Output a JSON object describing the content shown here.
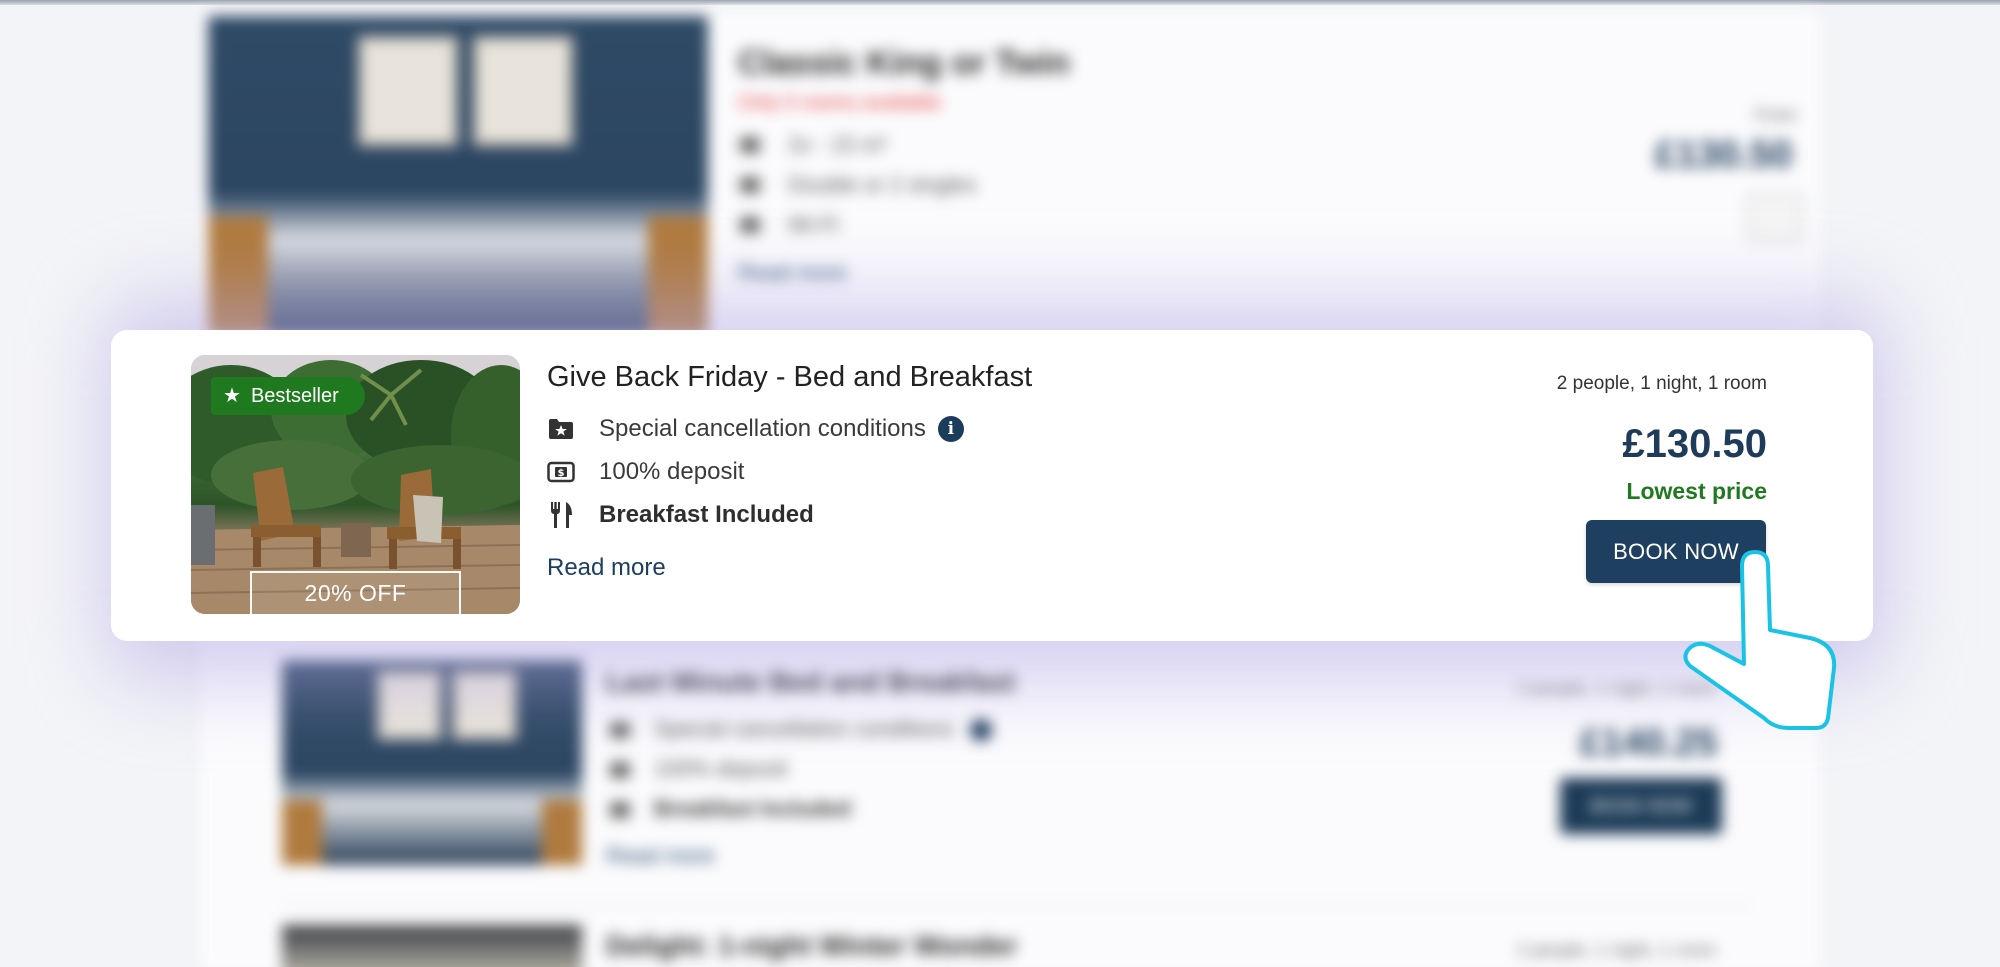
{
  "background_list": {
    "items": [
      {
        "title": "Classic King or Twin",
        "notice": "Only 5 rooms available",
        "features": [
          "2x - 15 m²",
          "Double or 2 singles",
          "Wi-Fi"
        ],
        "read_more": "Read more",
        "price_caption": "From",
        "price": "£130.50",
        "quantity": "1"
      },
      {
        "title": "Last Minute Bed and Breakfast",
        "features": [
          "Special cancellation conditions",
          "100% deposit",
          "Breakfast Included"
        ],
        "read_more": "Read more",
        "occupancy": "2 people, 1 night, 1 room",
        "price": "£140.25",
        "button": "BOOK NOW"
      },
      {
        "title": "Delight: 1-night Winter Wonder",
        "occupancy": "2 people, 1 night, 1 room"
      }
    ]
  },
  "offer": {
    "badge": "Bestseller",
    "discount": "20% OFF",
    "title": "Give Back Friday - Bed and Breakfast",
    "features": [
      {
        "icon": "folder-star-icon",
        "label": "Special cancellation conditions",
        "info": "i"
      },
      {
        "icon": "dollar-bill-icon",
        "label": "100% deposit"
      },
      {
        "icon": "fork-knife-icon",
        "label": "Breakfast Included"
      }
    ],
    "read_more": "Read more",
    "occupancy": "2 people, 1 night, 1 room",
    "price": "£130.50",
    "price_note": "Lowest price",
    "book_button": "BOOK NOW"
  },
  "colors": {
    "brand_navy": "#1e3f5f",
    "bestseller_green": "#1f7a1f",
    "halo_purple": "#b2a8e6",
    "pointer_cyan": "#19c3e6"
  }
}
